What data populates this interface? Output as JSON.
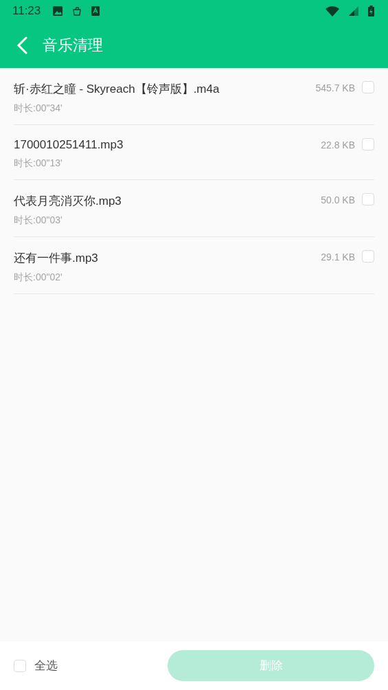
{
  "status_bar": {
    "time": "11:23"
  },
  "app_bar": {
    "title": "音乐清理"
  },
  "files": [
    {
      "name": "斩·赤红之瞳 - Skyreach【铃声版】.m4a",
      "duration": "时长:00\"34'",
      "size": "545.7 KB",
      "checked": false
    },
    {
      "name": "1700010251411.mp3",
      "duration": "时长:00\"13'",
      "size": "22.8 KB",
      "checked": false
    },
    {
      "name": "代表月亮消灭你.mp3",
      "duration": "时长:00\"03'",
      "size": "50.0 KB",
      "checked": false
    },
    {
      "name": "还有一件事.mp3",
      "duration": "时长:00\"02'",
      "size": "29.1 KB",
      "checked": false
    }
  ],
  "bottom_bar": {
    "select_all": {
      "label": "全选",
      "checked": false
    },
    "delete_button": {
      "label": "删除",
      "disabled": true
    }
  }
}
